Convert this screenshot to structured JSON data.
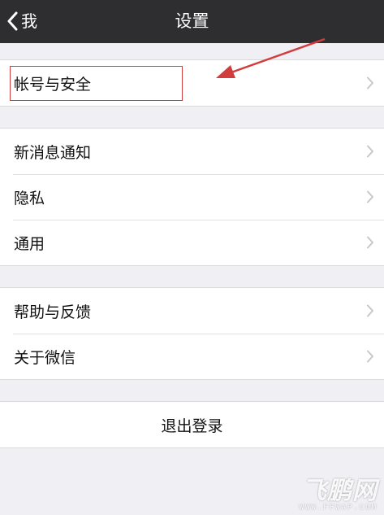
{
  "navbar": {
    "back_label": "我",
    "title": "设置"
  },
  "groups": {
    "account": {
      "items": [
        {
          "label": "帐号与安全"
        }
      ]
    },
    "general": {
      "items": [
        {
          "label": "新消息通知"
        },
        {
          "label": "隐私"
        },
        {
          "label": "通用"
        }
      ]
    },
    "support": {
      "items": [
        {
          "label": "帮助与反馈"
        },
        {
          "label": "关于微信"
        }
      ]
    },
    "logout": {
      "label": "退出登录"
    }
  },
  "watermark": {
    "logo": "飞鹏网",
    "url": "WWW.FFWAP.COM"
  },
  "colors": {
    "navbar_bg": "#2e2e31",
    "page_bg": "#efeff4",
    "annotation_red": "#d23c3c"
  },
  "icons": {
    "back": "chevron-left-icon",
    "disclosure": "chevron-right-icon",
    "annotation": "red-arrow-icon"
  }
}
